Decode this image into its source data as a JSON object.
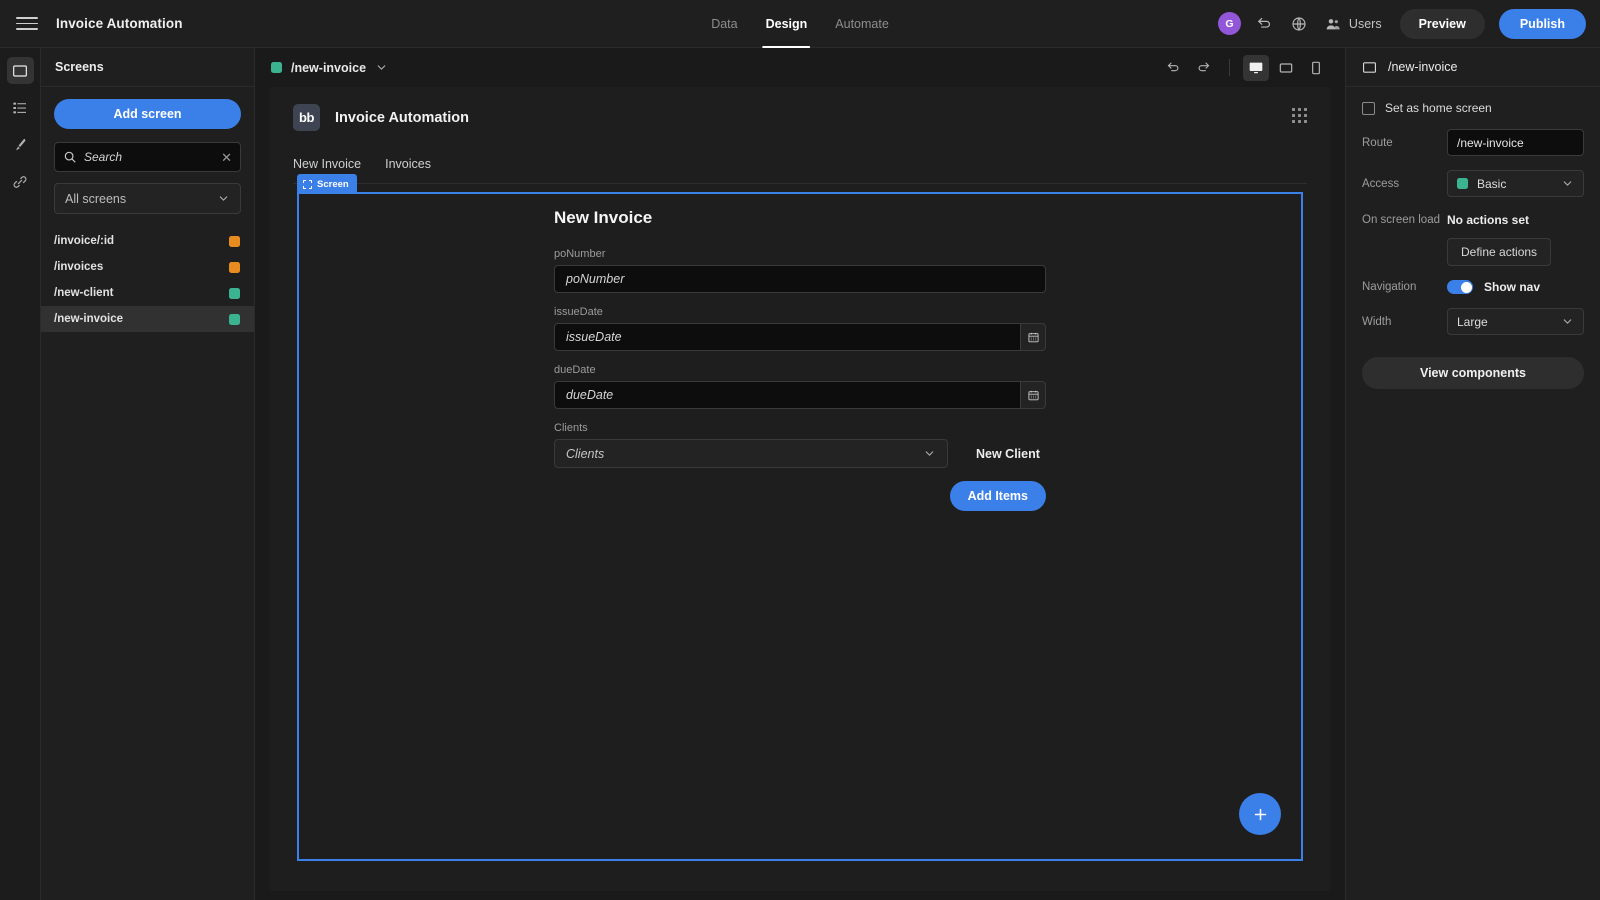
{
  "topbar": {
    "menu_icon": "hamburger-icon",
    "app_title": "Invoice Automation",
    "tabs": [
      {
        "label": "Data",
        "active": false
      },
      {
        "label": "Design",
        "active": true
      },
      {
        "label": "Automate",
        "active": false
      }
    ],
    "avatar_initial": "G",
    "avatar_color": "#9256d9",
    "undo_icon": "undo-icon",
    "globe_icon": "globe-icon",
    "users_icon": "users-icon",
    "users_label": "Users",
    "preview_label": "Preview",
    "publish_label": "Publish",
    "publish_color": "#3b7fe8"
  },
  "rail": {
    "items": [
      {
        "name": "screens-icon",
        "active": true
      },
      {
        "name": "components-list-icon",
        "active": false
      },
      {
        "name": "theme-brush-icon",
        "active": false
      },
      {
        "name": "links-chain-icon",
        "active": false
      }
    ]
  },
  "sidebar": {
    "title": "Screens",
    "add_screen_label": "Add screen",
    "search": {
      "placeholder": "Search",
      "value": "",
      "icon": "search-icon",
      "clear_icon": "close-icon"
    },
    "filter": {
      "label": "All screens",
      "icon": "chevron-down-icon"
    },
    "screens": [
      {
        "route": "/invoice/:id",
        "access_color": "#e88c1f"
      },
      {
        "route": "/invoices",
        "access_color": "#e88c1f"
      },
      {
        "route": "/new-client",
        "access_color": "#3bb391"
      },
      {
        "route": "/new-invoice",
        "access_color": "#3bb391",
        "selected": true
      }
    ]
  },
  "canvas_bar": {
    "route_label": "/new-invoice",
    "route_color": "#3bb391",
    "route_chevron": "chevron-down-icon",
    "undo_icon": "undo-icon",
    "redo_icon": "redo-icon",
    "devices": [
      {
        "name": "desktop-icon",
        "active": true
      },
      {
        "name": "tablet-icon",
        "active": false
      },
      {
        "name": "mobile-icon",
        "active": false
      }
    ]
  },
  "preview": {
    "logo_text": "bb",
    "app_name": "Invoice Automation",
    "nav_links": [
      "New Invoice",
      "Invoices"
    ],
    "grid_icon": "grid-dots-icon",
    "screen_badge": "Screen",
    "selection_color": "#3b7fe8",
    "form": {
      "title": "New Invoice",
      "fields": [
        {
          "label": "poNumber",
          "placeholder": "poNumber",
          "type": "text"
        },
        {
          "label": "issueDate",
          "placeholder": "issueDate",
          "type": "date",
          "button_icon": "calendar-icon"
        },
        {
          "label": "dueDate",
          "placeholder": "dueDate",
          "type": "date",
          "button_icon": "calendar-icon"
        },
        {
          "label": "Clients",
          "placeholder": "Clients",
          "type": "select",
          "chevron": "chevron-down-icon"
        }
      ],
      "new_client_label": "New Client",
      "add_items_label": "Add Items"
    },
    "fab_icon": "plus-icon"
  },
  "right_panel": {
    "header_icon": "screen-icon",
    "header_title": "/new-invoice",
    "home_screen_label": "Set as home screen",
    "home_screen_checked": false,
    "route_label": "Route",
    "route_value": "/new-invoice",
    "access_label": "Access",
    "access_value": "Basic",
    "access_color": "#3bb391",
    "onload_label": "On screen load",
    "onload_value": "No actions set",
    "define_actions_label": "Define actions",
    "navigation_label": "Navigation",
    "nav_toggle_label": "Show nav",
    "nav_toggle_on": true,
    "width_label": "Width",
    "width_value": "Large",
    "view_components_label": "View components"
  }
}
